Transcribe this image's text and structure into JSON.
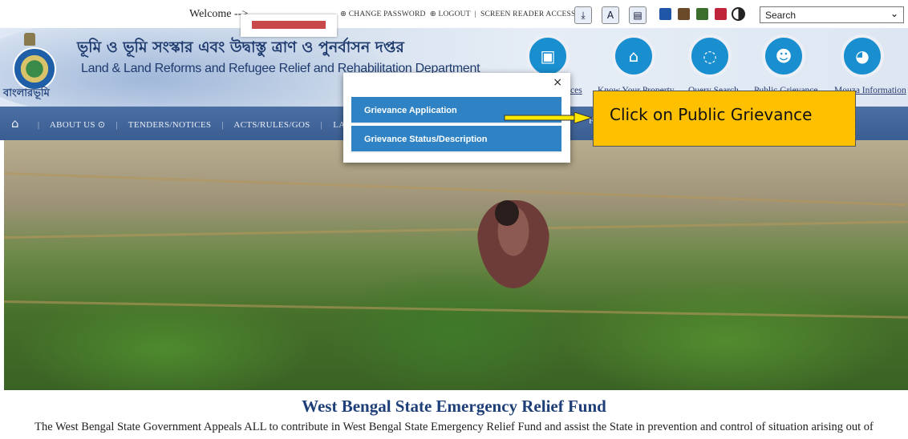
{
  "topbar": {
    "welcome": "Welcome -->",
    "links": [
      "CHANGE PASSWORD",
      "LOGOUT",
      "SCREEN READER ACCESS"
    ],
    "search": {
      "value": "Search"
    },
    "theme_colors": [
      "#1f56a8",
      "#6b4a2a",
      "#3a6e2a",
      "#c0243a"
    ]
  },
  "header": {
    "title_bn": "ভূমি ও ভূমি সংস্কার এবং উদ্বাস্তু ত্রাণ ও পুনর্বাসন দপ্তর",
    "title_en": "Land & Land Reforms and Refugee Relief and Rehabilitation Department",
    "logo_text": "বাংলারভূমি",
    "quick_links": [
      {
        "label": "ces",
        "icon": "id-card-icon"
      },
      {
        "label": "Know Your Property",
        "icon": "home-icon"
      },
      {
        "label": "Query Search",
        "icon": "chat-icon"
      },
      {
        "label": "Public Grievance",
        "icon": "users-icon"
      },
      {
        "label": "Mouza Information",
        "icon": "globe-icon"
      }
    ]
  },
  "nav": {
    "items": [
      "ABOUT US",
      "TENDERS/NOTICES",
      "ACTS/RULES/GOS",
      "LATEST N"
    ],
    "trailing": "F"
  },
  "dropdown": {
    "close": "×",
    "items": [
      "Grievance Application",
      "Grievance Status/Description"
    ]
  },
  "annotation": {
    "text": "Click on Public Grievance"
  },
  "relief": {
    "title": "West Bengal State Emergency Relief Fund",
    "text": "The West Bengal State Government Appeals ALL to contribute in West Bengal State Emergency Relief Fund and assist the State in prevention and control of situation arising out of"
  }
}
